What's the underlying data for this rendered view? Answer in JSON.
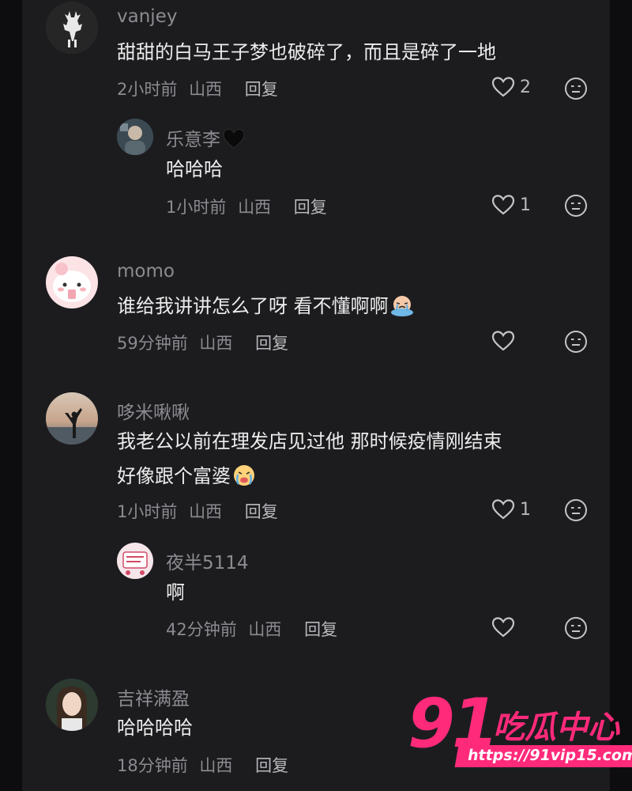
{
  "comments": [
    {
      "user": "vanjey",
      "text": "甜甜的白马王子梦也破碎了，而且是碎了一地",
      "time": "2小时前",
      "location": "山西",
      "reply_label": "回复",
      "likes": "2",
      "replies": [
        {
          "user": "乐意李",
          "text": "哈哈哈",
          "time": "1小时前",
          "location": "山西",
          "reply_label": "回复",
          "likes": "1"
        }
      ]
    },
    {
      "user": "momo",
      "text": "谁给我讲讲怎么了呀 看不懂啊啊",
      "time": "59分钟前",
      "location": "山西",
      "reply_label": "回复",
      "likes": ""
    },
    {
      "user": "哆米啾啾",
      "text_line1": "我老公以前在理发店见过他   那时候疫情刚结束",
      "text_line2": "好像跟个富婆",
      "time": "1小时前",
      "location": "山西",
      "reply_label": "回复",
      "likes": "1",
      "replies": [
        {
          "user": "夜半5114",
          "text": "啊",
          "time": "42分钟前",
          "location": "山西",
          "reply_label": "回复",
          "likes": ""
        }
      ]
    },
    {
      "user": "吉祥满盈",
      "text": "哈哈哈哈",
      "time": "18分钟前",
      "location": "山西",
      "reply_label": "回复"
    }
  ],
  "watermark": {
    "number": "91",
    "brand": "吃瓜中心",
    "url": "https://91vip15.com"
  },
  "colors": {
    "background": "#1c1c1f",
    "username": "#8b8b90",
    "text": "#ececec",
    "watermark": "#ff2a7a"
  },
  "icons": [
    "heart-outline-icon",
    "neutral-face-icon",
    "black-heart-emoji",
    "crying-emoji"
  ]
}
